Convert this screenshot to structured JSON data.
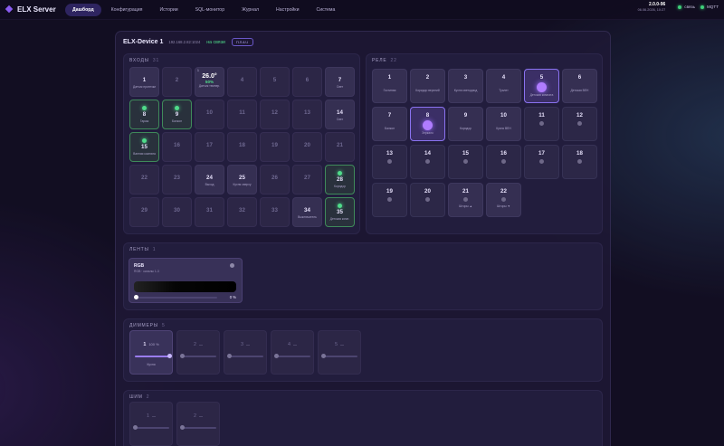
{
  "app": {
    "name": "ELX Server"
  },
  "nav": [
    "Дашборд",
    "Конфигурация",
    "Истории",
    "SQL-монитор",
    "Журнал",
    "Настройки",
    "Система"
  ],
  "header": {
    "version": "2.0.0-96",
    "datetime": "06.06.2026, 10:27",
    "status_net": "связь",
    "status_mqtt": "MQTT"
  },
  "device": {
    "name": "ELX-Device 1",
    "ip": "192.168.2.82:1024",
    "status": "на связи",
    "tag": "ПЛАЧ"
  },
  "inputs": {
    "title": "ВХОДЫ",
    "count": "31",
    "cells": [
      {
        "n": "1",
        "label": "Датчик протечки",
        "state": "named"
      },
      {
        "n": "2",
        "label": "",
        "state": "dim"
      },
      {
        "n": "3",
        "label": "Датчик темпер.",
        "state": "temp",
        "temp": "26.0°",
        "hum": "50%",
        "corner": "1"
      },
      {
        "n": "4",
        "label": "",
        "state": "dim"
      },
      {
        "n": "5",
        "label": "",
        "state": "dim"
      },
      {
        "n": "6",
        "label": "",
        "state": "dim"
      },
      {
        "n": "7",
        "label": "Свет",
        "state": "named"
      },
      {
        "n": "8",
        "label": "Гараж",
        "state": "lit"
      },
      {
        "n": "9",
        "label": "Балкон",
        "state": "lit"
      },
      {
        "n": "10",
        "label": "",
        "state": "dim"
      },
      {
        "n": "11",
        "label": "",
        "state": "dim"
      },
      {
        "n": "12",
        "label": "",
        "state": "dim"
      },
      {
        "n": "13",
        "label": "",
        "state": "dim"
      },
      {
        "n": "14",
        "label": "Свет",
        "state": "named"
      },
      {
        "n": "15",
        "label": "Ванная комната",
        "state": "lit"
      },
      {
        "n": "16",
        "label": "",
        "state": "dim"
      },
      {
        "n": "17",
        "label": "",
        "state": "dim"
      },
      {
        "n": "18",
        "label": "",
        "state": "dim"
      },
      {
        "n": "19",
        "label": "",
        "state": "dim"
      },
      {
        "n": "20",
        "label": "",
        "state": "dim"
      },
      {
        "n": "21",
        "label": "",
        "state": "dim"
      },
      {
        "n": "22",
        "label": "",
        "state": "dim"
      },
      {
        "n": "23",
        "label": "",
        "state": "dim"
      },
      {
        "n": "24",
        "label": "Выход",
        "state": "named"
      },
      {
        "n": "25",
        "label": "Кухня сверху",
        "state": "named"
      },
      {
        "n": "26",
        "label": "",
        "state": "dim"
      },
      {
        "n": "27",
        "label": "",
        "state": "dim"
      },
      {
        "n": "28",
        "label": "Коридор",
        "state": "lit"
      },
      {
        "n": "29",
        "label": "",
        "state": "dim"
      },
      {
        "n": "30",
        "label": "",
        "state": "dim"
      },
      {
        "n": "31",
        "label": "",
        "state": "dim"
      },
      {
        "n": "32",
        "label": "",
        "state": "dim"
      },
      {
        "n": "33",
        "label": "",
        "state": "dim"
      },
      {
        "n": "34",
        "label": "Выключатель",
        "state": "named"
      },
      {
        "n": "35",
        "label": "Детская комн.",
        "state": "lit"
      }
    ]
  },
  "relays": {
    "title": "РЕЛЕ",
    "count": "22",
    "cells": [
      {
        "n": "1",
        "label": "Гостиная",
        "state": "named"
      },
      {
        "n": "2",
        "label": "Коридор верхний",
        "state": "named"
      },
      {
        "n": "3",
        "label": "Кухня светодиод",
        "state": "named"
      },
      {
        "n": "4",
        "label": "Туалет",
        "state": "named"
      },
      {
        "n": "5",
        "label": "Детская комната",
        "state": "purple"
      },
      {
        "n": "6",
        "label": "Детская ВЕН",
        "state": "named"
      },
      {
        "n": "7",
        "label": "Балкон",
        "state": "named"
      },
      {
        "n": "8",
        "label": "Зеркало",
        "state": "purple"
      },
      {
        "n": "9",
        "label": "Коридор",
        "state": "named"
      },
      {
        "n": "10",
        "label": "Кухня ВЕН",
        "state": "named"
      },
      {
        "n": "11",
        "label": "",
        "state": "off"
      },
      {
        "n": "12",
        "label": "",
        "state": "off"
      },
      {
        "n": "13",
        "label": "",
        "state": "off"
      },
      {
        "n": "14",
        "label": "",
        "state": "off"
      },
      {
        "n": "15",
        "label": "",
        "state": "off"
      },
      {
        "n": "16",
        "label": "",
        "state": "off"
      },
      {
        "n": "17",
        "label": "",
        "state": "off"
      },
      {
        "n": "18",
        "label": "",
        "state": "off"
      },
      {
        "n": "19",
        "label": "",
        "state": "off"
      },
      {
        "n": "20",
        "label": "",
        "state": "off"
      },
      {
        "n": "21",
        "label": "Шторы ▲",
        "state": "named"
      },
      {
        "n": "22",
        "label": "Шторы ▼",
        "state": "named"
      }
    ]
  },
  "strips": {
    "title": "ЛЕНТЫ",
    "count": "1",
    "item": {
      "name": "RGB",
      "sub": "RGB · каналы 1-3",
      "percent": "0 %",
      "level": 0
    }
  },
  "dimmers": {
    "title": "ДИММЕРЫ",
    "count": "5",
    "items": [
      {
        "n": "1",
        "pct": "100 %",
        "label": "Кухня",
        "on": true,
        "level": 1.0
      },
      {
        "n": "2",
        "pct": "—",
        "label": "",
        "on": false,
        "level": 0
      },
      {
        "n": "3",
        "pct": "—",
        "label": "",
        "on": false,
        "level": 0
      },
      {
        "n": "4",
        "pct": "—",
        "label": "",
        "on": false,
        "level": 0
      },
      {
        "n": "5",
        "pct": "—",
        "label": "",
        "on": false,
        "level": 0
      }
    ]
  },
  "pwm": {
    "title": "ШИМ",
    "count": "2",
    "items": [
      {
        "n": "1",
        "pct": "—",
        "label": "",
        "on": false,
        "level": 0
      },
      {
        "n": "2",
        "pct": "—",
        "label": "",
        "on": false,
        "level": 0
      }
    ]
  }
}
